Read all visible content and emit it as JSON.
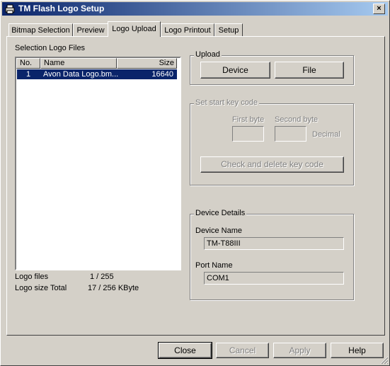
{
  "window": {
    "title": "TM Flash Logo Setup",
    "close_glyph": "×",
    "icon": "app-printer-icon"
  },
  "tabs": [
    {
      "label": "Bitmap Selection"
    },
    {
      "label": "Preview"
    },
    {
      "label": "Logo Upload",
      "active": true
    },
    {
      "label": "Logo Printout"
    },
    {
      "label": "Setup"
    }
  ],
  "selection": {
    "label": "Selection Logo Files",
    "columns": [
      "No.",
      "Name",
      "Size"
    ],
    "rows": [
      {
        "no": "1",
        "name": "Avon Data Logo.bm...",
        "size": "16640"
      }
    ]
  },
  "stats": {
    "logo_files_label": "Logo files",
    "logo_files_value": "1 / 255",
    "logo_size_label": "Logo size Total",
    "logo_size_value": "17 / 256 KByte"
  },
  "upload": {
    "legend": "Upload",
    "device_button": "Device",
    "file_button": "File"
  },
  "keycode": {
    "legend": "Set start key code",
    "first_byte_label": "First byte",
    "second_byte_label": "Second byte",
    "decimal_label": "Decimal",
    "check_button": "Check and delete key code"
  },
  "device_details": {
    "legend": "Device Details",
    "device_name_label": "Device Name",
    "device_name_value": "TM-T88III",
    "port_name_label": "Port Name",
    "port_name_value": "COM1"
  },
  "buttons": {
    "close": "Close",
    "cancel": "Cancel",
    "apply": "Apply",
    "help": "Help"
  },
  "colors": {
    "face": "#d4d0c8",
    "title_start": "#0a246a",
    "title_end": "#a6caf0",
    "selection": "#0a246a"
  }
}
